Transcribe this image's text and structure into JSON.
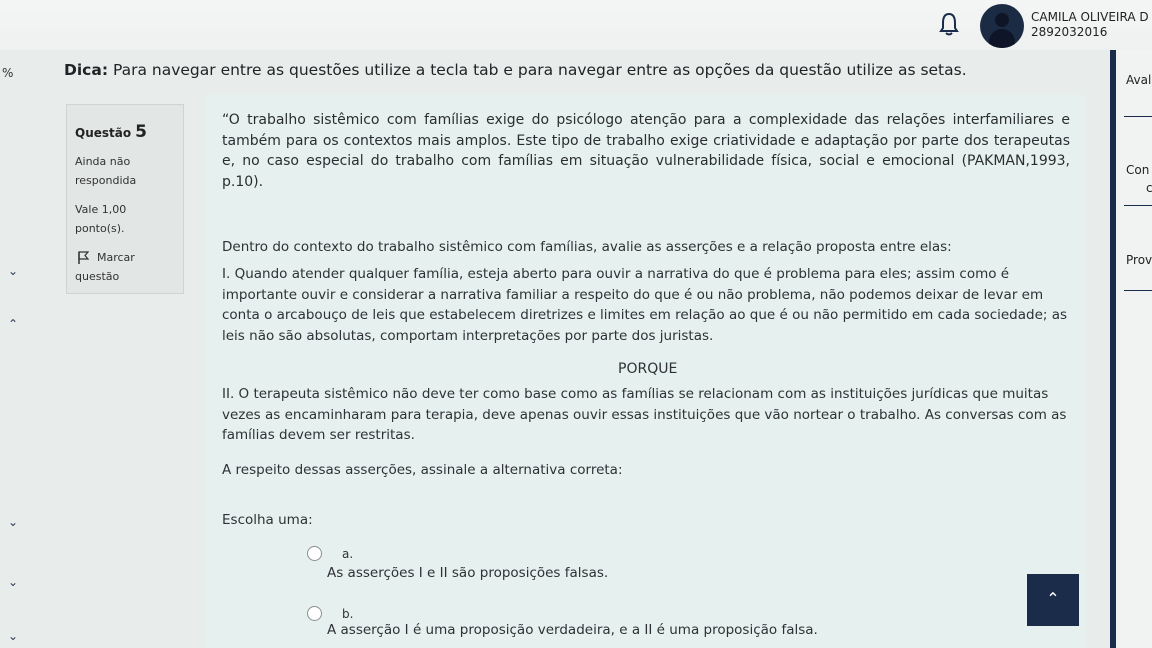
{
  "user": {
    "name": "CAMILA OLIVEIRA D",
    "id": "2892032016"
  },
  "rail": {
    "percent": "%"
  },
  "tip": {
    "bold": "Dica:",
    "text": " Para navegar entre as questões utilize a tecla tab e para navegar entre as opções da questão utilize as setas."
  },
  "question": {
    "label": "Questão",
    "number": "5",
    "status_1": "Ainda não",
    "status_2": "respondida",
    "value": "Vale 1,00",
    "points": "ponto(s).",
    "mark_1": "Marcar",
    "mark_2": "questão",
    "quote": "“O trabalho sistêmico com famílias exige do psicólogo atenção para a complexidade das relações interfamiliares e também para os contextos mais amplos. Este tipo de trabalho exige criatividade e adaptação por parte dos terapeutas e, no caso especial do trabalho com famílias em situação vulnerabilidade física, social e emocional (PAKMAN,1993, p.10).",
    "context": "Dentro do contexto do trabalho sistêmico com famílias, avalie as asserções e a relação proposta entre elas:",
    "assertion_1": "I. Quando atender qualquer família, esteja aberto para ouvir a narrativa do que é problema para eles; assim como é importante ouvir e considerar a narrativa familiar a respeito do que é ou não problema, não podemos deixar de levar em conta o arcabouço de leis que estabelecem diretrizes e limites em relação ao que é ou não permitido em cada sociedade; as leis não são absolutas, comportam interpretações por parte dos juristas.",
    "porque": "PORQUE",
    "assertion_2": "II. O terapeuta sistêmico não deve ter como base como as famílias se relacionam com as instituições jurídicas que muitas vezes as encaminharam para terapia, deve apenas ouvir essas instituições que vão nortear o trabalho. As conversas com as famílias devem ser restritas.",
    "prompt": "A respeito dessas asserções, assinale a alternativa correta:",
    "choose": "Escolha uma:",
    "options": [
      {
        "letter": "a.",
        "text": "As asserções I e II são proposições falsas."
      },
      {
        "letter": "b.",
        "text": "A asserção I é uma proposição verdadeira, e a II é uma proposição falsa."
      }
    ]
  },
  "right_panel": {
    "items": [
      "Aval",
      "Con",
      "c",
      "Prov"
    ]
  },
  "icons": {
    "bell": "bell-icon",
    "up": "chevron-up-icon",
    "flag": "flag-icon"
  },
  "colors": {
    "navy": "#1a2c4a",
    "panel": "#e6f0ee"
  }
}
